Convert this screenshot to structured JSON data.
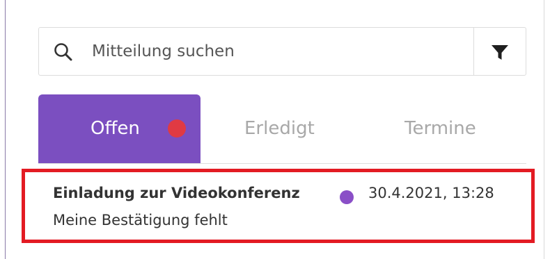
{
  "search": {
    "placeholder": "Mitteilung suchen",
    "value": ""
  },
  "filter": {
    "icon": "filter-icon"
  },
  "tabs": [
    {
      "label": "Offen",
      "active": true,
      "has_indicator": true
    },
    {
      "label": "Erledigt",
      "active": false
    },
    {
      "label": "Termine",
      "active": false
    }
  ],
  "messages": [
    {
      "title": "Einladung zur Videokonferenz",
      "unread": true,
      "timestamp": "30.4.2021, 13:28",
      "subtitle": "Meine Bestätigung fehlt",
      "highlighted": true
    }
  ],
  "colors": {
    "accent": "#7b4fc0",
    "indicator_red": "#e03a43",
    "unread_dot": "#8a4fc7",
    "highlight_border": "#e31b23",
    "inactive_tab_text": "#a8a8a8"
  }
}
